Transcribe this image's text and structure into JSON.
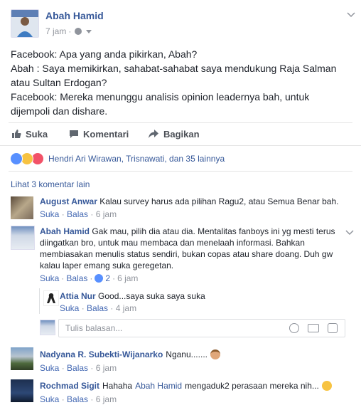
{
  "post": {
    "author": "Abah Hamid",
    "time": "7 jam",
    "separator": "·",
    "lines": [
      "Facebook: Apa yang anda pikirkan, Abah?",
      "Abah : Saya memikirkan, sahabat-sahabat saya mendukung Raja Salman",
      "atau Sultan Erdogan?",
      "Facebook: Mereka menunggu analisis opinion leadernya bah, untuk",
      "dijempoli dan dishare."
    ]
  },
  "actions": {
    "like": "Suka",
    "comment": "Komentari",
    "share": "Bagikan"
  },
  "reactions": {
    "text": "Hendri Ari Wirawan, Trisnawati, dan 35 lainnya"
  },
  "comments_header": {
    "more": "Lihat 3 komentar lain"
  },
  "comments": [
    {
      "author": "August Anwar",
      "text": "Kalau survey harus ada pilihan Ragu2, atau Semua Benar bah.",
      "like": "Suka",
      "reply": "Balas",
      "time": "6 jam"
    },
    {
      "author": "Abah Hamid",
      "text_lines": [
        "Gak mau, pilih dia atau dia. Mentalitas fanboys ini yg mesti terus",
        "diingatkan bro, untuk mau membaca dan menelaah informasi. Bahkan",
        "membiasakan menulis status sendiri, bukan copas atau share doang. Duh gw",
        "kalau laper emang suka geregetan."
      ],
      "like": "Suka",
      "reply": "Balas",
      "count": "2",
      "time": "6 jam"
    },
    {
      "author": "Attia Nur",
      "text": "Good...saya suka saya suka",
      "like": "Suka",
      "reply": "Balas",
      "time": "4 jam"
    },
    {
      "author": "Nadyana R. Subekti-Wijanarko",
      "text": "Nganu.......",
      "like": "Suka",
      "reply": "Balas",
      "time": "6 jam"
    },
    {
      "author": "Rochmad Sigit",
      "text_pre": "Hahaha",
      "mention": "Abah Hamid",
      "text_post": "mengaduk2 perasaan mereka nih...",
      "like": "Suka",
      "reply": "Balas",
      "time": "6 jam"
    }
  ],
  "reply_box": {
    "placeholder": "Tulis balasan..."
  },
  "colors": {
    "link": "#365899",
    "meta_link": "#4267b2",
    "divider": "#e5e5e5",
    "background": "#ffffff"
  }
}
